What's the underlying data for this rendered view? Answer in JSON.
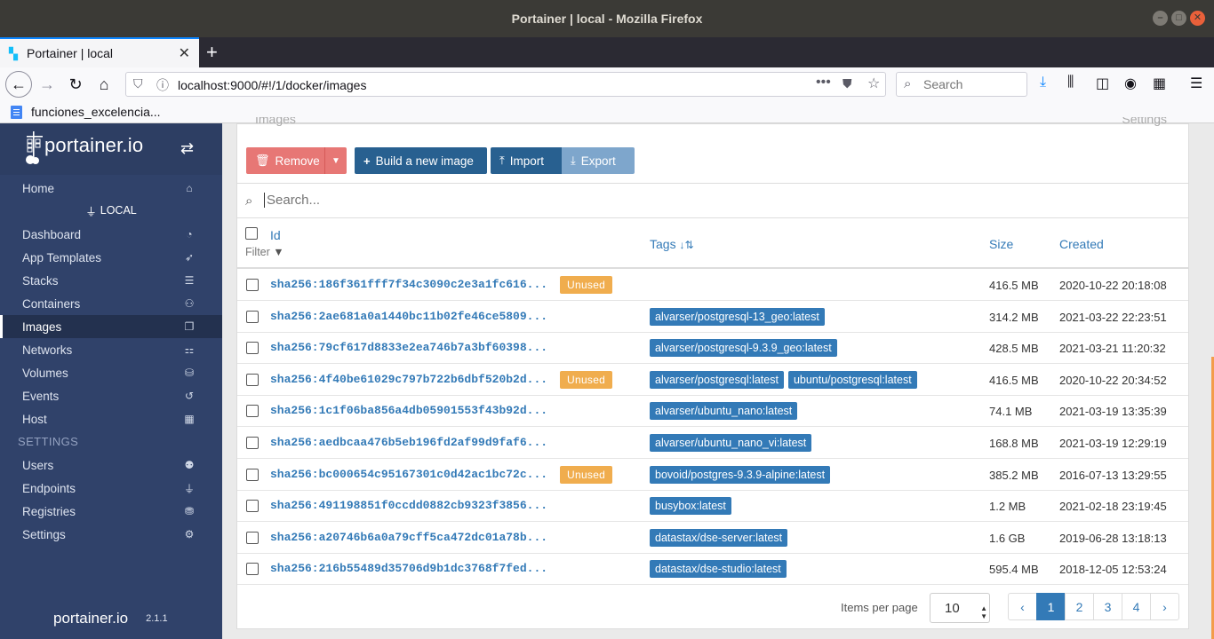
{
  "window": {
    "title": "Portainer | local - Mozilla Firefox",
    "minimize": "–",
    "maximize": "□",
    "close": "✕"
  },
  "browser": {
    "tab_title": "Portainer | local",
    "tab_close": "✕",
    "new_tab": "+",
    "url": "localhost:9000/#!/1/docker/images",
    "search_placeholder": "Search",
    "bookmark": "funciones_excelencia..."
  },
  "sidebar": {
    "brand": "portainer.io",
    "endpoint_label": "LOCAL",
    "items": [
      {
        "label": "Home",
        "icon": "⌂"
      },
      {
        "label": "Dashboard",
        "icon": "◔"
      },
      {
        "label": "App Templates",
        "icon": "➶"
      },
      {
        "label": "Stacks",
        "icon": "☰"
      },
      {
        "label": "Containers",
        "icon": "⚇"
      },
      {
        "label": "Images",
        "icon": "❐"
      },
      {
        "label": "Networks",
        "icon": "⚏"
      },
      {
        "label": "Volumes",
        "icon": "⛁"
      },
      {
        "label": "Events",
        "icon": "↺"
      },
      {
        "label": "Host",
        "icon": "▦"
      }
    ],
    "settings_heading": "SETTINGS",
    "settings_items": [
      {
        "label": "Users",
        "icon": "⚉"
      },
      {
        "label": "Endpoints",
        "icon": "⏚"
      },
      {
        "label": "Registries",
        "icon": "⛃"
      },
      {
        "label": "Settings",
        "icon": "⚙"
      }
    ],
    "footer_brand": "portainer.io",
    "version": "2.1.1"
  },
  "panel": {
    "title": "Images",
    "settings": "Settings"
  },
  "actions": {
    "remove": "Remove",
    "build": "Build a new image",
    "import": "Import",
    "export": "Export"
  },
  "search": {
    "placeholder": "Search..."
  },
  "table": {
    "headers": {
      "id": "Id",
      "filter": "Filter",
      "tags": "Tags",
      "size": "Size",
      "created": "Created"
    },
    "unused_label": "Unused",
    "rows": [
      {
        "id": "sha256:186f361fff7f34c3090c2e3a1fc616...",
        "unused": "Unused",
        "tags": [],
        "size": "416.5 MB",
        "created": "2020-10-22 20:18:08"
      },
      {
        "id": "sha256:2ae681a0a1440bc11b02fe46ce5809...",
        "unused": "",
        "tags": [
          "alvarser/postgresql-13_geo:latest"
        ],
        "size": "314.2 MB",
        "created": "2021-03-22 22:23:51"
      },
      {
        "id": "sha256:79cf617d8833e2ea746b7a3bf60398...",
        "unused": "",
        "tags": [
          "alvarser/postgresql-9.3.9_geo:latest"
        ],
        "size": "428.5 MB",
        "created": "2021-03-21 11:20:32"
      },
      {
        "id": "sha256:4f40be61029c797b722b6dbf520b2d...",
        "unused": "Unused",
        "tags": [
          "alvarser/postgresql:latest",
          "ubuntu/postgresql:latest"
        ],
        "size": "416.5 MB",
        "created": "2020-10-22 20:34:52"
      },
      {
        "id": "sha256:1c1f06ba856a4db05901553f43b92d...",
        "unused": "",
        "tags": [
          "alvarser/ubuntu_nano:latest"
        ],
        "size": "74.1 MB",
        "created": "2021-03-19 13:35:39"
      },
      {
        "id": "sha256:aedbcaa476b5eb196fd2af99d9faf6...",
        "unused": "",
        "tags": [
          "alvarser/ubuntu_nano_vi:latest"
        ],
        "size": "168.8 MB",
        "created": "2021-03-19 12:29:19"
      },
      {
        "id": "sha256:bc000654c95167301c0d42ac1bc72c...",
        "unused": "Unused",
        "tags": [
          "bovoid/postgres-9.3.9-alpine:latest"
        ],
        "size": "385.2 MB",
        "created": "2016-07-13 13:29:55"
      },
      {
        "id": "sha256:491198851f0ccdd0882cb9323f3856...",
        "unused": "",
        "tags": [
          "busybox:latest"
        ],
        "size": "1.2 MB",
        "created": "2021-02-18 23:19:45"
      },
      {
        "id": "sha256:a20746b6a0a79cff5ca472dc01a78b...",
        "unused": "",
        "tags": [
          "datastax/dse-server:latest"
        ],
        "size": "1.6 GB",
        "created": "2019-06-28 13:18:13"
      },
      {
        "id": "sha256:216b55489d35706d9b1dc3768f7fed...",
        "unused": "",
        "tags": [
          "datastax/dse-studio:latest"
        ],
        "size": "595.4 MB",
        "created": "2018-12-05 12:53:24"
      }
    ]
  },
  "pagination": {
    "items_per_page_label": "Items per page",
    "items_per_page": "10",
    "prev": "‹",
    "next": "›",
    "pages": [
      "1",
      "2",
      "3",
      "4"
    ],
    "current": "1"
  },
  "colors": {
    "sidebar": "#30426a",
    "primary": "#337ab7",
    "danger": "#e77775",
    "warning": "#f0ad4e"
  }
}
